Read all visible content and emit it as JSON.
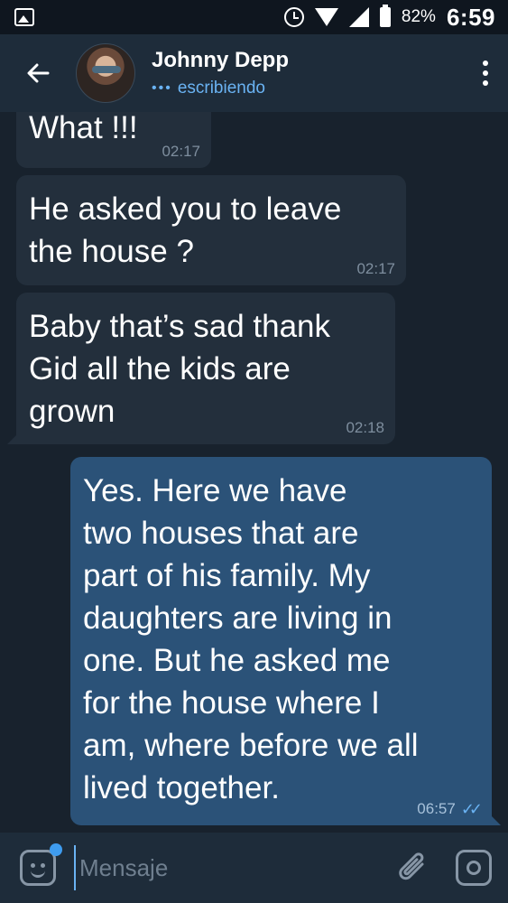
{
  "status_bar": {
    "battery_percent": "82%",
    "time": "6:59",
    "icons": [
      "image-icon",
      "alarm-icon",
      "wifi-icon",
      "signal-icon",
      "battery-icon"
    ]
  },
  "header": {
    "contact_name": "Johnny Depp",
    "status_dots": "•••",
    "status": "escribiendo",
    "icons": [
      "back-arrow-icon",
      "more-vertical-icon"
    ]
  },
  "messages": [
    {
      "direction": "incoming",
      "text": "What !!!",
      "time": "02:17"
    },
    {
      "direction": "incoming",
      "text": "He asked you to leave\nthe house ?",
      "time": "02:17"
    },
    {
      "direction": "incoming",
      "text": "Baby that’s sad thank\nGid all the kids are\ngrown",
      "time": "02:18"
    },
    {
      "direction": "outgoing",
      "text": "Yes. Here we have\ntwo houses that are\npart of his family. My\ndaughters are living in\none. But he asked me\nfor the house where I\nam, where before we all\nlived together.",
      "time": "06:57",
      "read": true
    }
  ],
  "input_bar": {
    "placeholder": "Mensaje",
    "icons": [
      "sticker-icon",
      "attach-icon",
      "camera-icon"
    ]
  },
  "colors": {
    "background": "#18222d",
    "header": "#1e2c3a",
    "incoming_bubble": "#232f3c",
    "outgoing_bubble": "#2b5278",
    "accent": "#6ab3f3"
  }
}
